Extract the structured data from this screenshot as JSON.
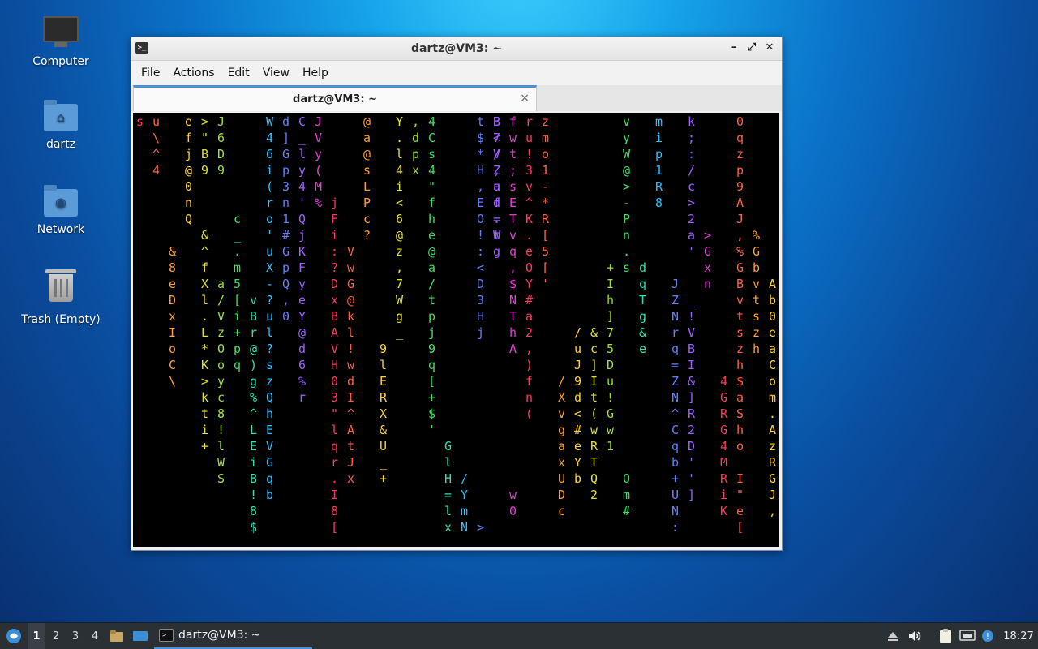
{
  "desktop": {
    "icons": [
      {
        "label": "Computer",
        "icon": "computer-icon"
      },
      {
        "label": "dartz",
        "icon": "home-folder-icon"
      },
      {
        "label": "Network",
        "icon": "network-folder-icon"
      },
      {
        "label": "Trash (Empty)",
        "icon": "trash-icon"
      }
    ]
  },
  "window": {
    "title": "dartz@VM3: ~",
    "controls": {
      "minimize": "–",
      "maximize": "⤢",
      "close": "✕"
    },
    "menu": [
      "File",
      "Actions",
      "Edit",
      "View",
      "Help"
    ],
    "tab": {
      "label": "dartz@VM3: ~",
      "close": "×"
    }
  },
  "terminal": {
    "palette": [
      "#ff3860",
      "#ff6040",
      "#ffa030",
      "#ffd030",
      "#e0e030",
      "#a0e030",
      "#40e060",
      "#30e0b0",
      "#30c0ff",
      "#6080ff",
      "#a060ff",
      "#e040d0"
    ],
    "columns": [
      {
        "start": 0,
        "text": "s"
      },
      {
        "start": 0,
        "text": "u\\^4",
        "repeat": 0
      },
      {
        "start": 0,
        "text": "efj@0nQ"
      },
      {
        "start": 0,
        "text": ">\"B9"
      },
      {
        "start": 0,
        "text": "J6D9"
      },
      {
        "start": 0,
        "text": "W46i(ro'uX-?ul?szQhEVGqb"
      },
      {
        "start": 0,
        "text": "d]Gp3n1#GpQ,0"
      },
      {
        "start": 0,
        "text": "C_ly4'QjKFyeY@d6%r"
      },
      {
        "start": 0,
        "text": "JVy(M%"
      },
      {
        "start": 0,
        "text": "@a@sLPc?"
      },
      {
        "start": 0,
        "text": "Y.l4i<6@z,7Wg_"
      },
      {
        "start": 0,
        "text": ",dpx"
      },
      {
        "start": 0,
        "text": "4Cs4\"fhe@a/tpj9q[+$'"
      },
      {
        "start": 0,
        "text": "t$*H,EO!:<D3Hj"
      },
      {
        "start": 0,
        "text": "B7VZad=W"
      },
      {
        "start": 0,
        "text": "fwt;sETvq,$NThA"
      },
      {
        "start": 0,
        "text": "ru!3v^K.eOY#a2,)fn("
      },
      {
        "start": 0,
        "text": "zmo1-*R[5['"
      },
      {
        "start": 0,
        "text": "vyW@>-Pn.s"
      },
      {
        "start": 0,
        "text": "mip1R8"
      },
      {
        "start": 0,
        "text": "k;:/c>2a'"
      },
      {
        "start": 0,
        "text": "0qzp9A"
      },
      {
        "start": 0,
        "text": "B</,uf.tg"
      }
    ],
    "trails": [
      {
        "x": 2,
        "start": 8,
        "text": "&8eDxIoC\\"
      },
      {
        "x": 4,
        "start": 7,
        "text": "&^fXl.L*K>kti+"
      },
      {
        "x": 5,
        "start": 10,
        "text": "a/VzOoyc8!lWS"
      },
      {
        "x": 6,
        "start": 6,
        "text": "c_.m5[i+pq"
      },
      {
        "x": 7,
        "start": 11,
        "text": "vBr@)g%^LEiB!8$"
      },
      {
        "x": 12,
        "start": 5,
        "text": "jFi:?DxBAVH03\"lqr.I8["
      },
      {
        "x": 13,
        "start": 8,
        "text": "VwG@kl!wdI^AtJx"
      },
      {
        "x": 15,
        "start": 14,
        "text": "9lERX&U_+"
      },
      {
        "x": 19,
        "start": 20,
        "text": "GlH=lx"
      },
      {
        "x": 20,
        "start": 22,
        "text": "/YmN"
      },
      {
        "x": 21,
        "start": 25,
        "text": ">"
      },
      {
        "x": 23,
        "start": 23,
        "text": "w0"
      },
      {
        "x": 26,
        "start": 16,
        "text": "/XvgaxUDc"
      },
      {
        "x": 27,
        "start": 13,
        "text": "/uJ9d<#eYb"
      },
      {
        "x": 28,
        "start": 13,
        "text": "&c]It(wRTQ2"
      },
      {
        "x": 29,
        "start": 9,
        "text": "+Ih]75Du!Gw1"
      },
      {
        "x": 30,
        "start": 22,
        "text": "Om#"
      },
      {
        "x": 31,
        "start": 9,
        "text": "dqTg&e"
      },
      {
        "x": 33,
        "start": 10,
        "text": "JZNrq=ZN^Cqb+UN:"
      },
      {
        "x": 34,
        "start": 11,
        "text": "_!VBI&]R2D'']"
      },
      {
        "x": 35,
        "start": 7,
        "text": ">Gxn"
      },
      {
        "x": 36,
        "start": 16,
        "text": "4GRG4MRiK"
      },
      {
        "x": 37,
        "start": 6,
        "text": "J,%GBvtszh$aSho I\"e["
      },
      {
        "x": 38,
        "start": 7,
        "text": "%Gbvtszh"
      },
      {
        "x": 39,
        "start": 10,
        "text": "Ab0eaCom.AzRGJ,"
      },
      {
        "x": 40,
        "start": 8,
        "text": "6`XH@b"
      }
    ]
  },
  "taskbar": {
    "start_icon": "start-menu-icon",
    "workspaces": [
      "1",
      "2",
      "3",
      "4"
    ],
    "active_workspace": "1",
    "launchers": [
      "file-manager-icon",
      "show-desktop-icon"
    ],
    "task": {
      "label": "dartz@VM3: ~",
      "icon": "terminal-icon"
    },
    "tray": [
      "eject-icon",
      "volume-icon",
      "clipboard-icon",
      "network-icon",
      "update-icon"
    ],
    "clock": "18:27"
  }
}
